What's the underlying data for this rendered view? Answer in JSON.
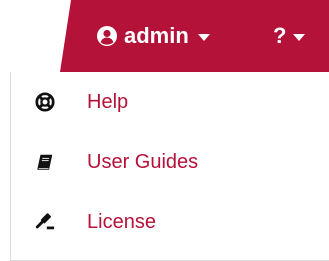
{
  "colors": {
    "brand": "#b5123a",
    "text_on_brand": "#ffffff",
    "menu_text": "#b5123a",
    "icon": "#111111"
  },
  "header": {
    "user_menu": {
      "icon": "user-circle-icon",
      "label": "admin",
      "caret_icon": "caret-down-icon"
    },
    "help_menu": {
      "label": "?",
      "caret_icon": "caret-down-icon"
    }
  },
  "dropdown": {
    "items": [
      {
        "label": "Help",
        "icon": "life-ring-icon"
      },
      {
        "label": "User Guides",
        "icon": "book-icon"
      },
      {
        "label": "License",
        "icon": "gavel-icon"
      }
    ]
  }
}
